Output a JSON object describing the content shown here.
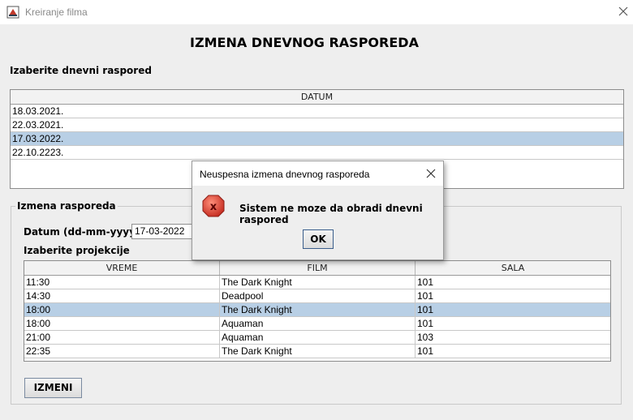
{
  "window": {
    "title": "Kreiranje filma"
  },
  "page_title": "IZMENA DNEVNOG RASPOREDA",
  "schedule_section": {
    "label": "Izaberite dnevni raspored",
    "column": "DATUM",
    "rows": [
      "18.03.2021.",
      "22.03.2021.",
      "17.03.2022.",
      "22.10.2223."
    ],
    "selected_index": 2
  },
  "edit_group": {
    "title": "Izmena rasporeda",
    "date_label": "Datum (dd-mm-yyyy)",
    "date_value": "17-03-2022",
    "projections_label": "Izaberite projekcije",
    "columns": [
      "VREME",
      "FILM",
      "SALA"
    ],
    "rows": [
      [
        "11:30",
        "The Dark Knight",
        "101"
      ],
      [
        "14:30",
        "Deadpool",
        "101"
      ],
      [
        "18:00",
        "The Dark Knight",
        "101"
      ],
      [
        "18:00",
        "Aquaman",
        "101"
      ],
      [
        "21:00",
        "Aquaman",
        "103"
      ],
      [
        "22:35",
        "The Dark Knight",
        "101"
      ]
    ],
    "selected_index": 2,
    "submit_label": "IZMENI"
  },
  "dialog": {
    "title": "Neuspesna izmena dnevnog rasporeda",
    "message": "Sistem ne moze da obradi dnevni raspored",
    "ok_label": "OK",
    "icon": "error-icon"
  },
  "colors": {
    "selection": "#b8cfe5",
    "error_red": "#d9362f"
  }
}
